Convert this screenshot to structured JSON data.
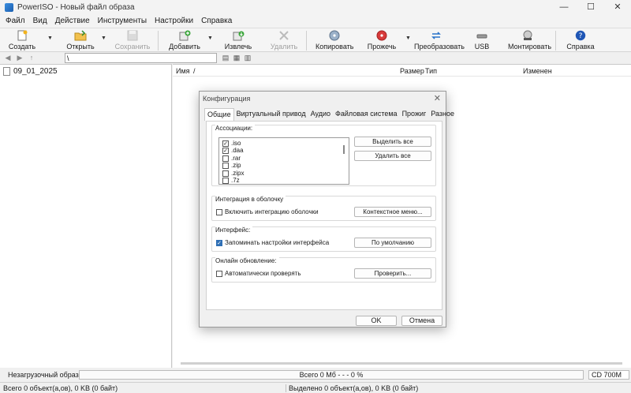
{
  "window": {
    "title": "PowerISO - Новый файл образа",
    "minimize": "—",
    "maximize": "☐",
    "close": "✕"
  },
  "menu": [
    "Файл",
    "Вид",
    "Действие",
    "Инструменты",
    "Настройки",
    "Справка"
  ],
  "toolbar": {
    "create": "Создать",
    "open": "Открыть",
    "save": "Сохранить",
    "add": "Добавить",
    "extract": "Извлечь",
    "delete": "Удалить",
    "copy": "Копировать",
    "burn": "Прожечь",
    "convert": "Преобразовать",
    "usb": "USB",
    "mount": "Монтировать",
    "help": "Справка"
  },
  "addressbar": {
    "path": "\\"
  },
  "tree": {
    "item": "09_01_2025"
  },
  "list_header": {
    "name": "Имя",
    "sort_mark": "/",
    "size": "Размер",
    "type": "Тип",
    "modified": "Изменен"
  },
  "status": {
    "boot": "Незагрузочный образ",
    "total": "Всего  0 Мб  - - -  0 %",
    "capacity": "CD 700M",
    "left": "Всего 0 объект(а,ов), 0 KB (0 байт)",
    "right": "Выделено 0 объект(а,ов), 0 KB (0 байт)"
  },
  "dialog": {
    "title": "Конфигурация",
    "close": "✕",
    "tabs": [
      "Общие",
      "Виртуальный привод",
      "Аудио",
      "Файловая система",
      "Прожиг",
      "Разное"
    ],
    "assoc": {
      "label": "Ассоциации:",
      "items": [
        {
          "ext": ".iso",
          "checked": true
        },
        {
          "ext": ".daa",
          "checked": true
        },
        {
          "ext": ".rar",
          "checked": false
        },
        {
          "ext": ".zip",
          "checked": false
        },
        {
          "ext": ".zipx",
          "checked": false
        },
        {
          "ext": ".7z",
          "checked": false
        }
      ],
      "select_all": "Выделить все",
      "remove_all": "Удалить все"
    },
    "shell": {
      "label": "Интеграция в оболочку",
      "checkbox": "Включить интеграцию оболочки",
      "button": "Контекстное меню..."
    },
    "ui": {
      "label": "Интерфейс:",
      "checkbox": "Запоминать настройки интерфейса",
      "button": "По умолчанию"
    },
    "update": {
      "label": "Онлайн обновление:",
      "checkbox": "Автоматически проверять",
      "button": "Проверить..."
    },
    "ok": "OK",
    "cancel": "Отмена"
  },
  "colors": {
    "accent": "#2f6fb5",
    "help_icon": "#1f56b5",
    "burn_icon": "#d83a3a"
  }
}
